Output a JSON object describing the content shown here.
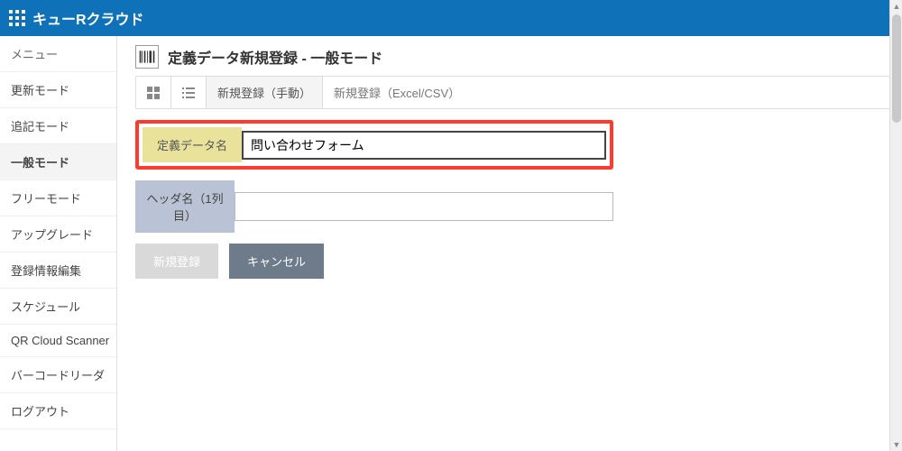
{
  "topbar": {
    "title": "キューRクラウド"
  },
  "sidebar": {
    "menu_label": "メニュー",
    "items": [
      {
        "label": "更新モード"
      },
      {
        "label": "追記モード"
      },
      {
        "label": "一般モード",
        "active": true
      },
      {
        "label": "フリーモード"
      },
      {
        "label": "アップグレード"
      },
      {
        "label": "登録情報編集"
      },
      {
        "label": "スケジュール"
      },
      {
        "label": "QR Cloud Scanner"
      },
      {
        "label": "バーコードリーダ"
      },
      {
        "label": "ログアウト"
      }
    ]
  },
  "page": {
    "title": "定義データ新規登録 - 一般モード"
  },
  "toolbar": {
    "tab_manual": "新規登録（手動）",
    "tab_excel": "新規登録（Excel/CSV）"
  },
  "form": {
    "data_name_label": "定義データ名",
    "data_name_value": "問い合わせフォーム",
    "header_label": "ヘッダ名（1列目）",
    "header_value": ""
  },
  "actions": {
    "submit": "新規登録",
    "cancel": "キャンセル"
  }
}
